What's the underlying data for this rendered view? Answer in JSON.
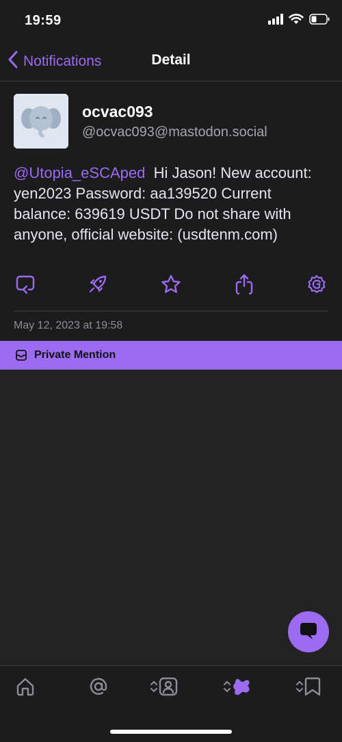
{
  "status_bar": {
    "time": "19:59"
  },
  "nav": {
    "back_label": "Notifications",
    "title": "Detail"
  },
  "post": {
    "display_name": "ocvac093",
    "handle": "@ocvac093@mastodon.social",
    "mention": "@Utopia_eSCAped",
    "text": "Hi Jason! New account: yen2023 Password: aa139520 Current balance: 639619 USDT Do not share with anyone, official website: (usdtenm.com)",
    "timestamp": "May 12, 2023 at 19:58",
    "visibility": "Private Mention"
  },
  "actions": [
    "reply-icon",
    "boost-icon",
    "favorite-icon",
    "share-icon",
    "more-icon"
  ],
  "tabs": [
    "home-icon",
    "mentions-icon",
    "profile-icon",
    "fediverse-icon",
    "bookmarks-icon"
  ],
  "colors": {
    "accent": "#9b6cf0",
    "background": "#232323",
    "surface": "#1c1c1e",
    "secondary_text": "#a6a6ab"
  }
}
